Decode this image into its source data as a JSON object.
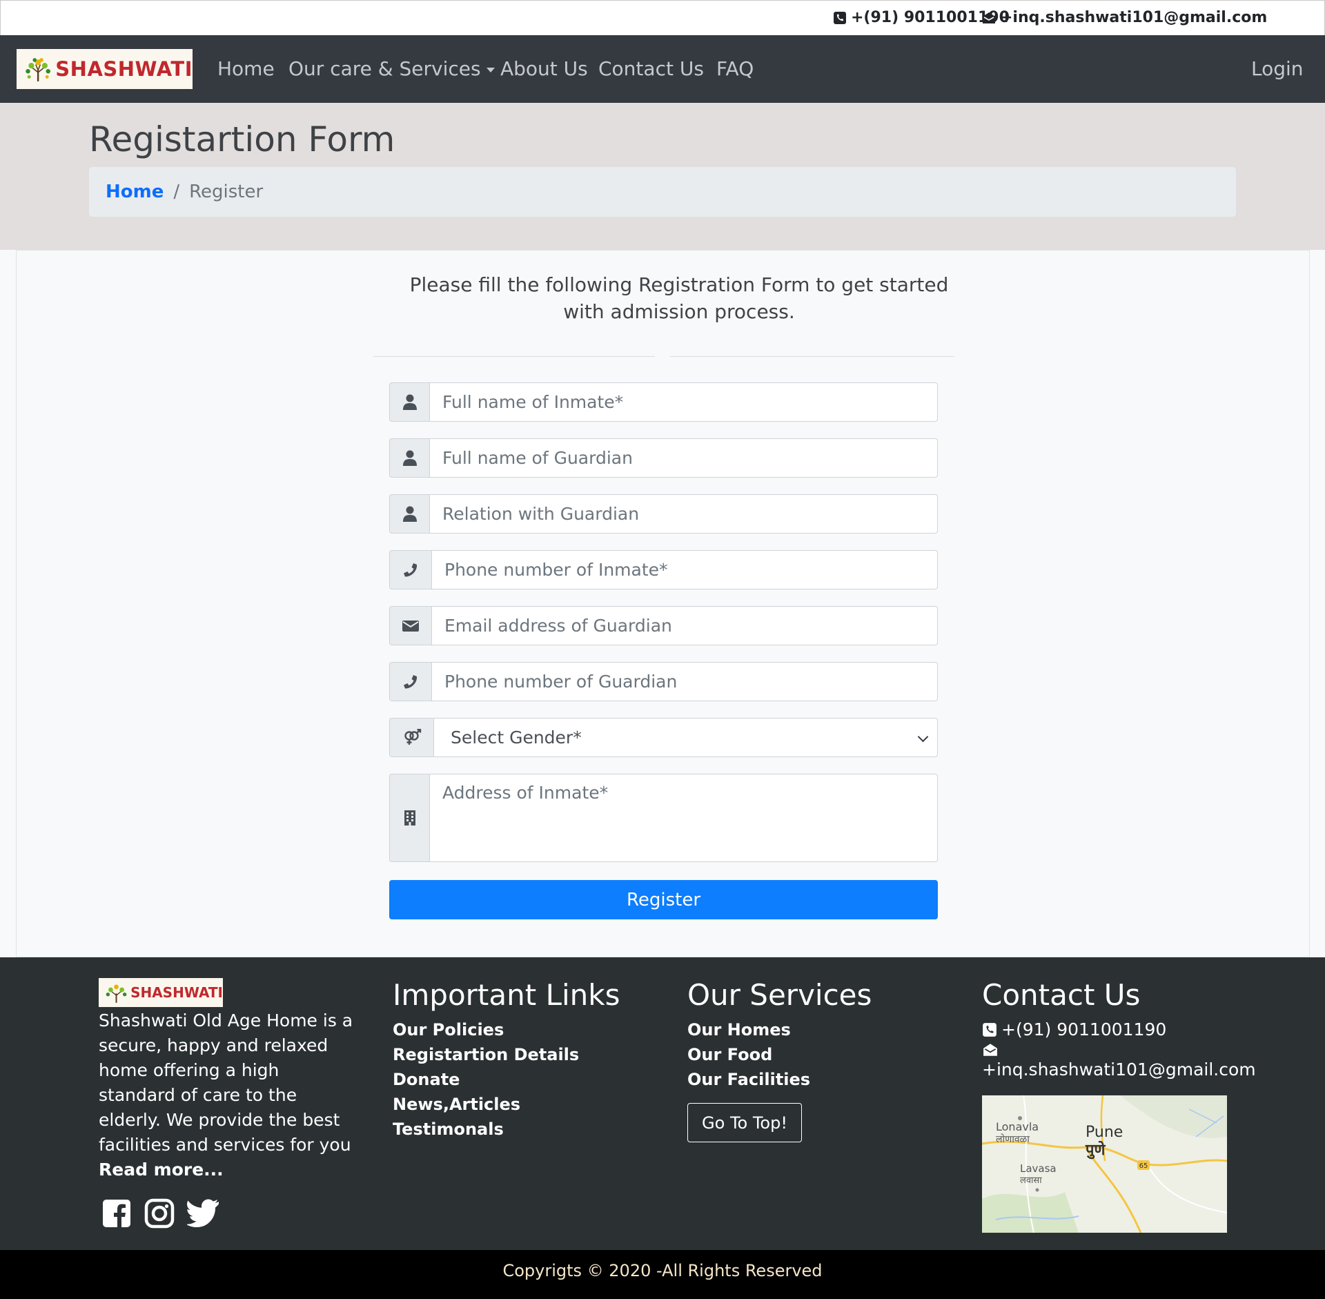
{
  "topbar": {
    "phone": "+(91) 9011001190",
    "email": "+inq.shashwati101@gmail.com"
  },
  "navbar": {
    "brand": "SHASHWATI",
    "links": {
      "home": "Home",
      "services": "Our care & Services",
      "about": "About Us",
      "contact": "Contact Us",
      "faq": "FAQ",
      "login": "Login"
    }
  },
  "page": {
    "title": "Registartion Form",
    "breadcrumb": {
      "home": "Home",
      "separator": "/",
      "current": "Register"
    }
  },
  "form": {
    "intro": "Please fill the following Registration Form to get started with admission process.",
    "fields": {
      "inmate_name": "Full name of Inmate*",
      "guardian_name": "Full name of Guardian",
      "relation": "Relation with Guardian",
      "inmate_phone": "Phone number of Inmate*",
      "guardian_email": "Email address of Guardian",
      "guardian_phone": "Phone number of Guardian",
      "gender": "Select Gender*",
      "address": "Address of Inmate*"
    },
    "submit": "Register"
  },
  "footer": {
    "brand": "SHASHWATI",
    "about": "Shashwati Old Age Home is a secure, happy and relaxed home offering a high standard of care to the elderly. We provide the best facilities and services for you",
    "read_more": "Read more...",
    "important_links": {
      "title": "Important Links",
      "items": [
        "Our Policies",
        "Registartion Details",
        "Donate",
        "News,Articles",
        "Testimonals"
      ]
    },
    "services": {
      "title": "Our Services",
      "items": [
        "Our Homes",
        "Our Food",
        "Our Facilities"
      ],
      "go_top": "Go To Top!"
    },
    "contact": {
      "title": "Contact Us",
      "phone": "+(91) 9011001190",
      "email": "+inq.shashwati101@gmail.com"
    },
    "map": {
      "labels": {
        "lonavla": "Lonavla",
        "lonavla_local": "लोणावळा",
        "pune": "Pune",
        "pune_local": "पुणे",
        "lavasa": "Lavasa",
        "lavasa_local": "लवासा",
        "route": "65"
      }
    },
    "copyright": "Copyrigts © 2020 -All Rights Reserved"
  },
  "colors": {
    "navbar": "#343a40",
    "primary": "#0d7efd",
    "brand_red": "#c0282d",
    "footer": "#2b3033"
  }
}
